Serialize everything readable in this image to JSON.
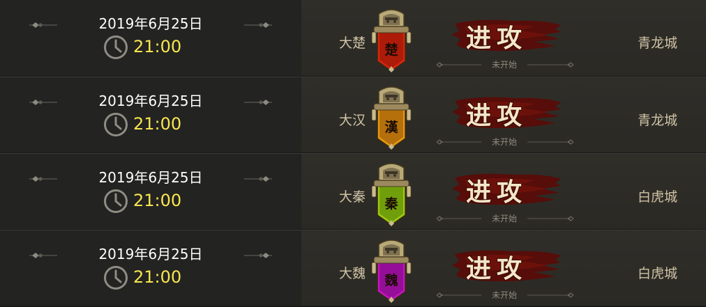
{
  "battles": [
    {
      "date": "2019年6月25日",
      "time": "21:00",
      "kingdom": "大楚",
      "banner_char": "楚",
      "banner_color": "#d8260e",
      "banner_dark": "#8a1205",
      "action": "进攻",
      "status": "未开始",
      "city": "青龙城"
    },
    {
      "date": "2019年6月25日",
      "time": "21:00",
      "kingdom": "大汉",
      "banner_char": "漢",
      "banner_color": "#e69a12",
      "banner_dark": "#8c4f06",
      "action": "进攻",
      "status": "未开始",
      "city": "青龙城"
    },
    {
      "date": "2019年6月25日",
      "time": "21:00",
      "kingdom": "大秦",
      "banner_char": "秦",
      "banner_color": "#9ccd12",
      "banner_dark": "#4f7a05",
      "action": "进攻",
      "status": "未开始",
      "city": "白虎城"
    },
    {
      "date": "2019年6月25日",
      "time": "21:00",
      "kingdom": "大魏",
      "banner_char": "魏",
      "banner_color": "#c614c4",
      "banner_dark": "#6e0a72",
      "action": "进攻",
      "status": "未开始",
      "city": "白虎城"
    }
  ]
}
